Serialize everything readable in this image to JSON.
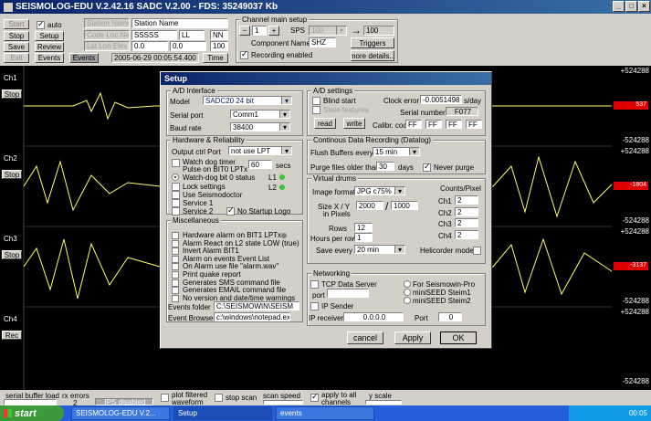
{
  "app": {
    "title": "SEISMOLOG-EDU V.2.42.16 SADC V.2.00 - FDS: 35249037 Kb"
  },
  "toolbar": {
    "start": "Start",
    "stop": "Stop",
    "save": "Save",
    "exit": "Exit",
    "auto": "auto",
    "setup": "Setup",
    "review": "Review",
    "events": "Events",
    "events2": "Events",
    "time": "Time"
  },
  "station": {
    "name_label": "Station Name",
    "name_value": "Station Name",
    "code_label": "Code Loc Net",
    "code": "SSSSS",
    "loc": "LL",
    "net": "NN",
    "lat_label": "Lat Lon Elev",
    "lat": "0.0",
    "lon": "0.0",
    "elev": "100",
    "datetime": "2005-06-29 00:05:54.400"
  },
  "channel_setup": {
    "title": "Channel main setup",
    "minus": "−",
    "ch": "1",
    "plus": "+",
    "sps_label": "SPS",
    "sps": "100",
    "arrow": "→",
    "value": "100",
    "component_label": "Component Name:",
    "component": "SHZ",
    "triggers": "Triggers",
    "recording": "Recording enabled",
    "more": "more details..."
  },
  "traces": {
    "channels": [
      {
        "name": "Ch1",
        "btn": "Stop",
        "top": "+524288",
        "mid": "537",
        "bot": "-524288"
      },
      {
        "name": "Ch2",
        "btn": "Stop",
        "top": "+524288",
        "mid": "-1804",
        "bot": "-524288"
      },
      {
        "name": "Ch3",
        "btn": "Stop",
        "top": "+524288",
        "mid": "-3137",
        "bot": "-524288"
      },
      {
        "name": "Ch4",
        "btn": "Rec",
        "top": "+524288",
        "mid": "",
        "bot": "-524288"
      }
    ]
  },
  "dialog": {
    "title": "Setup",
    "ad_interface": {
      "caption": "A/D Interface",
      "model_label": "Model",
      "model": "SADC20 24 bit",
      "serial_label": "Serial port",
      "serial": "Comm1",
      "baud_label": "Baud rate",
      "baud": "38400"
    },
    "ad_settings": {
      "caption": "A/D settings",
      "blind": "Blind start",
      "state": "State features",
      "clock_label": "Clock error",
      "clock": "-0.0051498",
      "clock_unit": "s/day",
      "serial_label": "Serial number",
      "serial": "F077",
      "read": "read",
      "write": "write",
      "calib_label": "Calibr. code",
      "calib": [
        "FF",
        "FF",
        "FF",
        "FF"
      ]
    },
    "hardware": {
      "caption": "Hardware & Reliability",
      "output_label": "Output ctrl Port",
      "output": "not use LPT",
      "watchdog": "Watch dog timer",
      "pulse": "Pulse on BIT0 LPTx",
      "secs_value": "60",
      "secs": "secs",
      "wd_status": "Watch-dog bit 0 status",
      "l1": "L1",
      "l2": "L2",
      "lock": "Lock settings",
      "seismodoctor": "Use Seismodoctor",
      "service1": "Service 1",
      "service2": "Service 2",
      "nologo": "No Startup Logo"
    },
    "continuous": {
      "caption": "Continous Data Recording (Datalog)",
      "flush_label": "Flush Buffers every",
      "flush": "15 min",
      "purge_label": "Purge files older than",
      "purge": "30",
      "days": "days",
      "never": "Never purge"
    },
    "drums": {
      "caption": "Virtual drums",
      "format_label": "Image format",
      "format": "JPG c75%",
      "size_label": "Size X / Y",
      "pixels": "in Pixels",
      "x": "2000",
      "y": "1000",
      "rows_label": "Rows",
      "rows": "12",
      "hours_label": "Hours per row",
      "hours": "1",
      "save_label": "Save every",
      "save": "20 min",
      "counts_label": "Counts/Pixel",
      "ch1": "Ch1",
      "ch2": "Ch2",
      "ch3": "Ch3",
      "ch4": "Ch4",
      "c1": "2",
      "c2": "2",
      "c3": "2",
      "c4": "2",
      "heli": "Helicorder mode"
    },
    "misc": {
      "caption": "Miscellaneous",
      "items": [
        "Hardware alarm on BIT1 LPTx",
        "Alarm React on L2 state LOW (true)",
        "Invert Alarm BIT1",
        "Alarm on events Event List",
        "On Alarm use file   \"alarm.wav\"",
        "Print quake report",
        "Generates SMS command file",
        "Generates EMAIL command file",
        "No version and date/time warnings"
      ],
      "folder_label": "Events folder",
      "folder": "C:\\SEISMOWIN\\SEISM",
      "browser_label": "Event Browser",
      "browser": "c:\\windows\\notepad.ex"
    },
    "network": {
      "caption": "Networking",
      "tcp": "TCP Data Server",
      "port_label": "port",
      "port_value": "",
      "for_seismo": "For Seismowin-Pro",
      "steim1": "miniSEED Steim1",
      "steim2": "miniSEED Steim2",
      "ip_sender": "IP Sender",
      "ip_label": "IP receiver",
      "ip": "0.0.0.0",
      "port2_label": "Port",
      "port2": "0"
    },
    "buttons": {
      "cancel": "cancel",
      "apply": "Apply",
      "ok": "OK"
    }
  },
  "bottombar": {
    "serial_buffer": "serial buffer load",
    "rx_errors": "rx errors",
    "rx_value": "2",
    "ips": "IPS disabled",
    "plot_filtered": "plot filtered waveform",
    "stop_scan": "stop scan",
    "scan_speed": "scan speed",
    "apply_all": "apply to all channels",
    "y_scale": "y scale"
  },
  "taskbar": {
    "start": "start",
    "tasks": [
      "SEISMOLOG-EDU V.2...",
      "Setup",
      "events"
    ],
    "time": "00:05"
  }
}
